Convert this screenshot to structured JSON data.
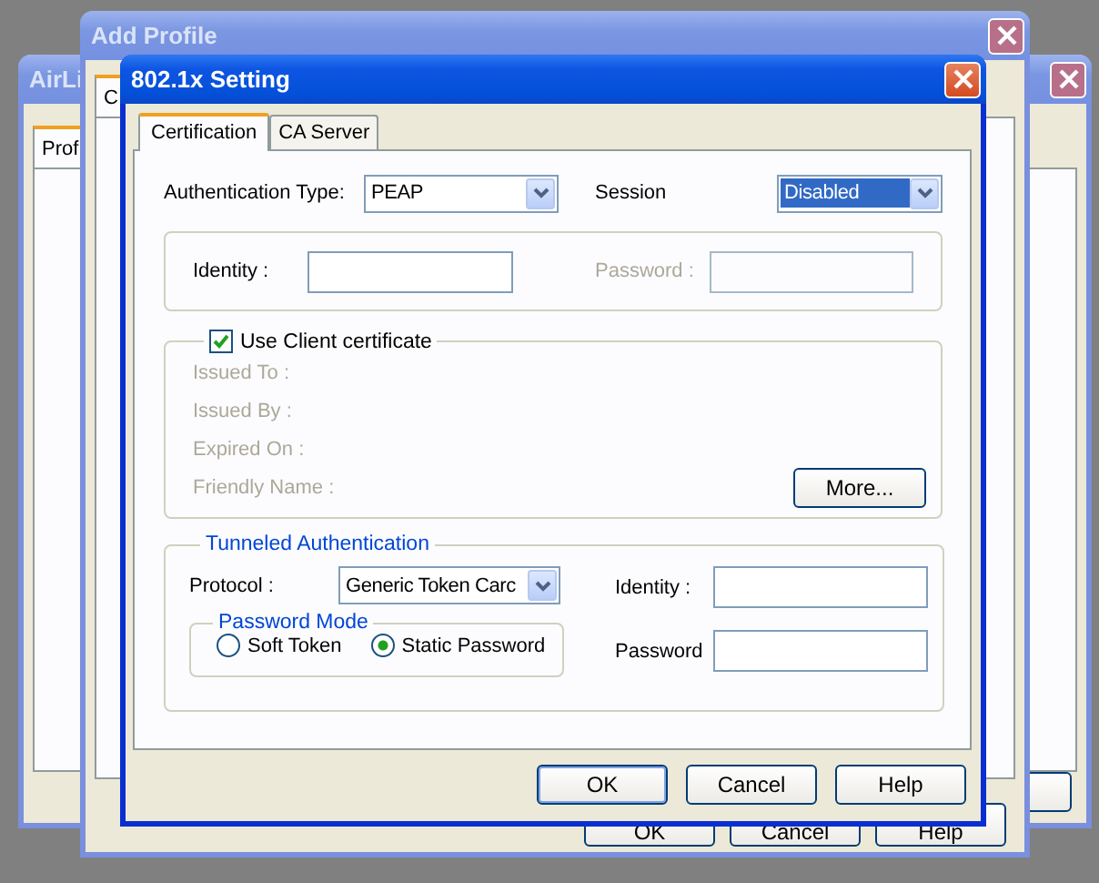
{
  "background_window": {
    "title": "AirLi",
    "tab": "Prof"
  },
  "parent_window": {
    "title": "Add Profile",
    "tab": "C",
    "buttons": [
      "OK",
      "Cancel",
      "Help"
    ]
  },
  "dialog": {
    "title": "802.1x Setting",
    "tabs": [
      {
        "label": "Certification",
        "selected": true
      },
      {
        "label": "CA Server",
        "selected": false
      }
    ],
    "authentication_type": {
      "label": "Authentication Type:",
      "value": "PEAP"
    },
    "session": {
      "label": "Session",
      "value": "Disabled"
    },
    "identity": {
      "label": "Identity :",
      "disabled": false
    },
    "password": {
      "label": "Password :",
      "disabled": true
    },
    "client_certificate": {
      "label": "Use Client certificate",
      "checked": true,
      "fields": [
        "Issued To :",
        "Issued By :",
        "Expired On :",
        "Friendly Name :"
      ],
      "more_button": "More..."
    },
    "tunneled": {
      "title": "Tunneled Authentication",
      "protocol": {
        "label": "Protocol :",
        "value": "Generic Token Carc"
      },
      "identity_label": "Identity :",
      "password_label": "Password",
      "password_mode": {
        "title": "Password Mode",
        "options": [
          {
            "label": "Soft Token",
            "selected": false
          },
          {
            "label": "Static Password",
            "selected": true
          }
        ]
      }
    },
    "buttons": [
      "OK",
      "Cancel",
      "Help"
    ]
  }
}
